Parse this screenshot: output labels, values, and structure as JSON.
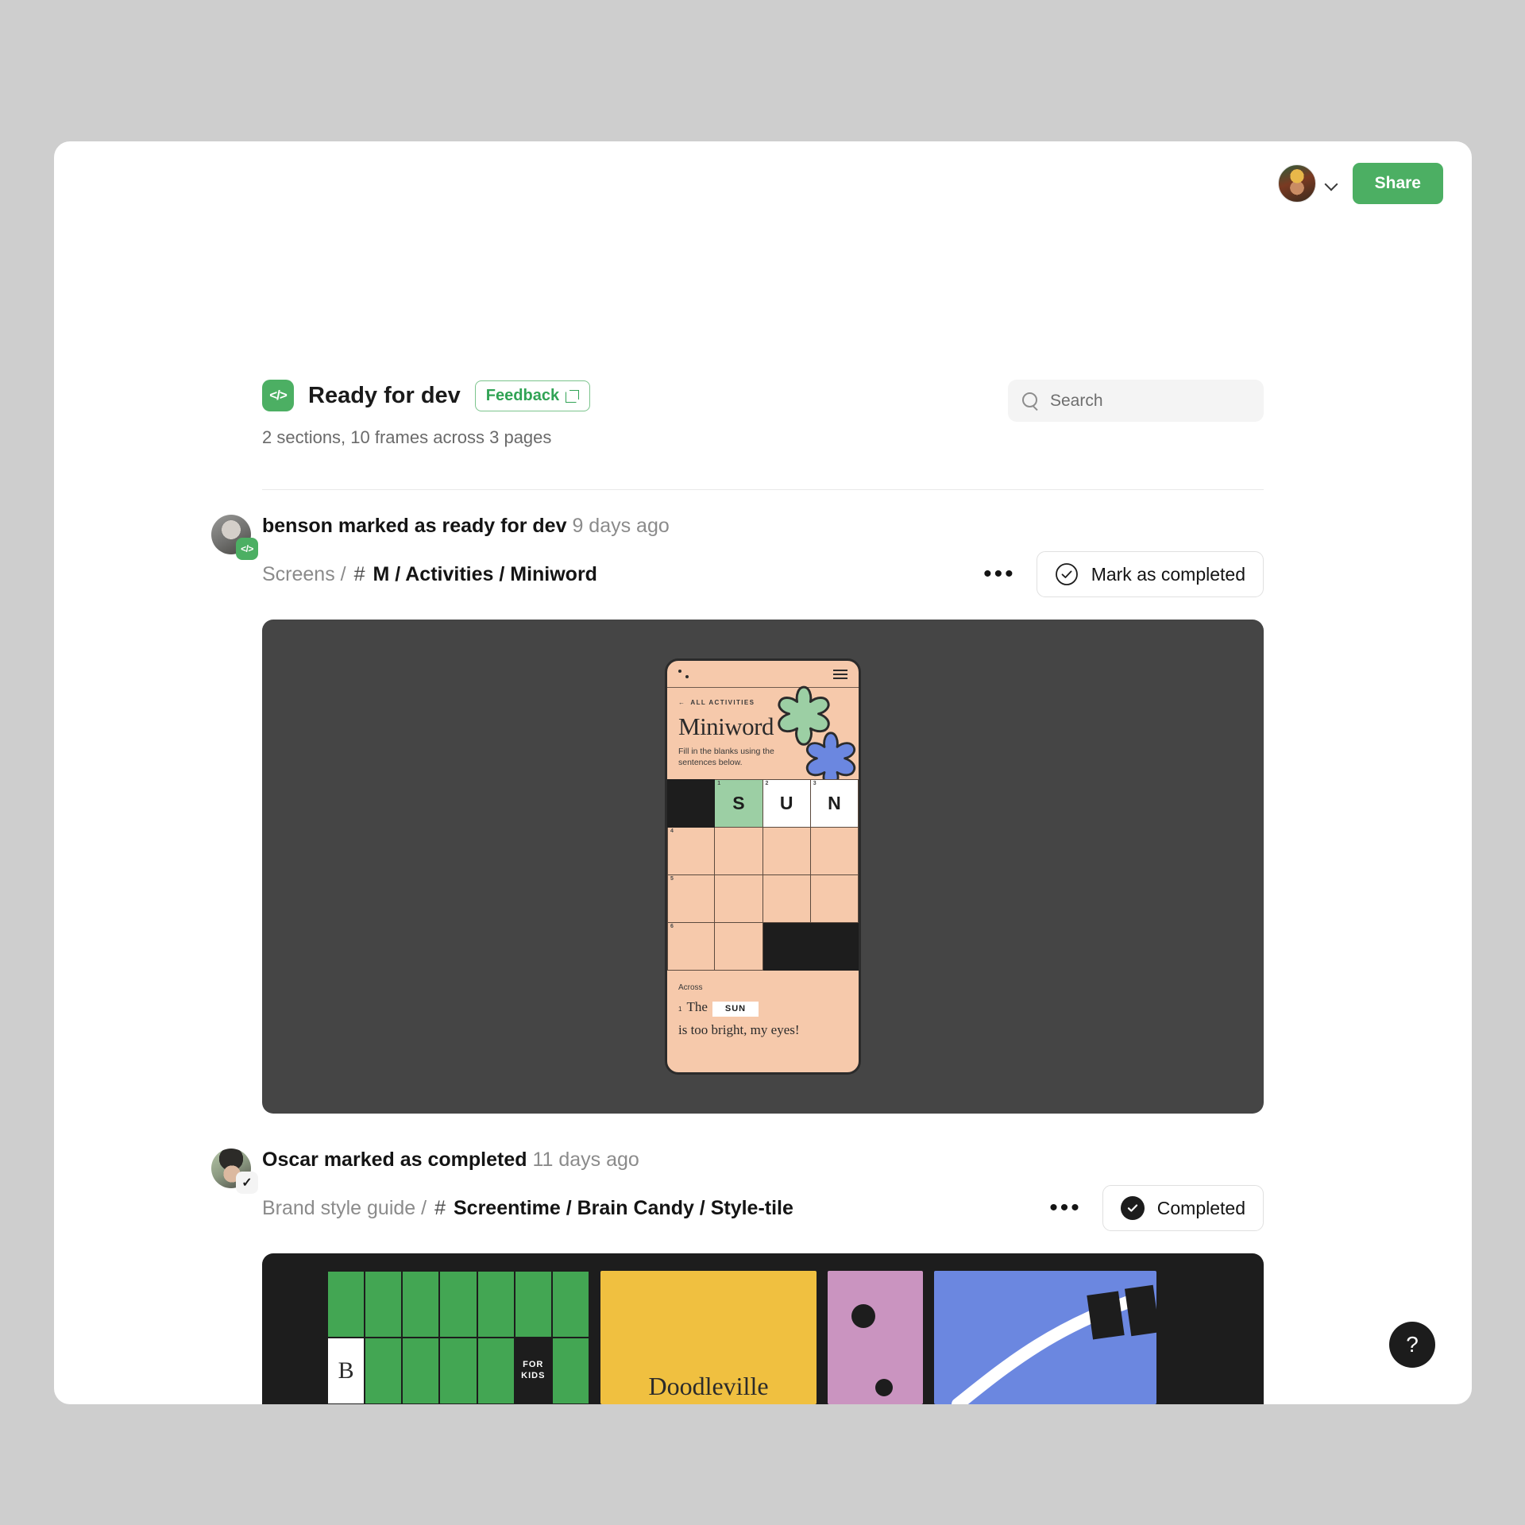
{
  "topbar": {
    "share_label": "Share",
    "avatar_name": "user-avatar",
    "chevron": "chevron-down-icon"
  },
  "header": {
    "badge_glyph": "</>",
    "title": "Ready for dev",
    "feedback_label": "Feedback",
    "subtitle": "2 sections, 10 frames across 3 pages"
  },
  "search": {
    "placeholder": "Search",
    "value": ""
  },
  "entries": [
    {
      "actor": "benson marked as ready for dev",
      "time": "9 days ago",
      "crumb_prefix": "Screens /",
      "crumb_hash": "#",
      "crumb_path": "M / Activities / Miniword",
      "menu_label": "•••",
      "status_label": "Mark as completed",
      "status_type": "outline"
    },
    {
      "actor": "Oscar marked as completed",
      "time": "11 days ago",
      "crumb_prefix": "Brand style guide /",
      "crumb_hash": "#",
      "crumb_path": "Screentime / Brain Candy / Style-tile",
      "menu_label": "•••",
      "status_label": "Completed",
      "status_type": "filled"
    }
  ],
  "miniword": {
    "back_label": "ALL ACTIVITIES",
    "title": "Miniword",
    "description": "Fill in the blanks using the sentences below.",
    "grid": [
      [
        {
          "type": "black",
          "num": "",
          "letter": ""
        },
        {
          "type": "green",
          "num": "1",
          "letter": "S"
        },
        {
          "type": "white",
          "num": "2",
          "letter": "U"
        },
        {
          "type": "white",
          "num": "3",
          "letter": "N"
        }
      ],
      [
        {
          "type": "open",
          "num": "4",
          "letter": ""
        },
        {
          "type": "open",
          "num": "",
          "letter": ""
        },
        {
          "type": "open",
          "num": "",
          "letter": ""
        },
        {
          "type": "open",
          "num": "",
          "letter": ""
        }
      ],
      [
        {
          "type": "open",
          "num": "5",
          "letter": ""
        },
        {
          "type": "open",
          "num": "",
          "letter": ""
        },
        {
          "type": "open",
          "num": "",
          "letter": ""
        },
        {
          "type": "open",
          "num": "",
          "letter": ""
        }
      ],
      [
        {
          "type": "open",
          "num": "6",
          "letter": ""
        },
        {
          "type": "open",
          "num": "",
          "letter": ""
        },
        {
          "type": "black",
          "num": "",
          "letter": ""
        },
        {
          "type": "black",
          "num": "",
          "letter": ""
        }
      ]
    ],
    "clues_heading": "Across",
    "clue": {
      "num": "1",
      "before": "The",
      "answer": "SUN",
      "after": "is too bright, my eyes!"
    }
  },
  "styletile": {
    "letter_cell": "B",
    "kids_cell": "FOR\nKIDS",
    "kids_line1": "FOR",
    "kids_line2": "KIDS",
    "doodleville": "Doodleville"
  },
  "help": {
    "label": "?"
  },
  "colors": {
    "brand_green": "#4caf63",
    "canvas_dark": "#454545",
    "tile_dark": "#1d1d1d",
    "peach": "#f6c9ab",
    "grid_green": "#43a653",
    "yellow": "#f0c040",
    "pink": "#ca94c0",
    "blue": "#6b87e0"
  }
}
